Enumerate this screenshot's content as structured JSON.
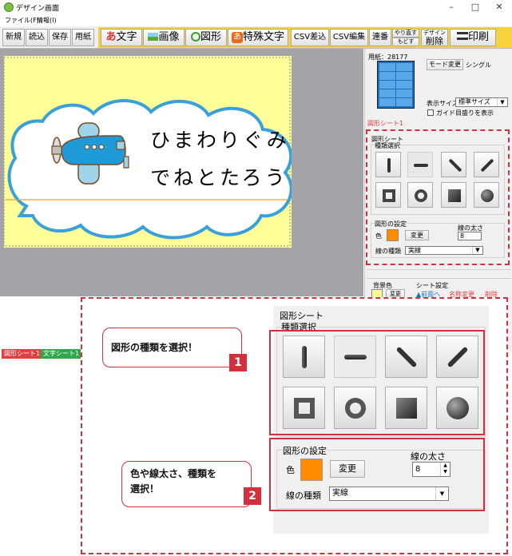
{
  "window": {
    "title": "デザイン画面",
    "minimize_icon": "–",
    "maximize_icon": "□",
    "close_icon": "✕"
  },
  "menu": {
    "file": "ファイル(F)",
    "info": "情報(I)"
  },
  "toolbar": {
    "new": "新規",
    "open": "読込",
    "save": "保存",
    "paper": "用紙",
    "text": "文字",
    "image": "画像",
    "shape": "図形",
    "special_text": "特殊文字",
    "csv_insert": "CSV差込",
    "csv_edit": "CSV編集",
    "serial": "連番",
    "redo": "やり直す",
    "undo": "もどす",
    "design_delete_top": "デザイン",
    "design_delete_bottom": "削除",
    "print": "印刷"
  },
  "canvas": {
    "line1": "ひまわりぐみ",
    "line2": "でねとたろう"
  },
  "sheet_tabs": {
    "shape_sheet": "図形シート1",
    "text_sheet": "文字シート1"
  },
  "right_panel": {
    "paper_label": "用紙：28177",
    "mode_change": "モード変更",
    "mode_value": "シングル",
    "display_size_label": "表示サイズ",
    "display_size_value": "標準サイズ",
    "guide_label": "ガイド目盛りを表示",
    "active_sheet": "図形シート1",
    "shape_sheet_title": "図形シート",
    "type_select": "種類選択",
    "shape_settings": "図形の設定",
    "color_label": "色",
    "change": "変更",
    "line_width_label": "線の太さ",
    "line_width_value": "8",
    "line_type_label": "線の種類",
    "line_type_value": "実線",
    "bg_color_label": "背景色",
    "bg_change": "変更",
    "sheet_settings": "シート設定",
    "front": "▲前面へ",
    "rename": "名称変更",
    "delete": "削除"
  },
  "callouts": {
    "step1": "図形の種類を選択！",
    "step1_num": "1",
    "step2_line1": "色や線太さ、種類を",
    "step2_line2": "選択！",
    "step2_num": "2"
  },
  "colors": {
    "accent_red": "#d32f3c",
    "shape_color": "#ff8c00",
    "paper": "#ffff99",
    "airplane": "#1e9ad6",
    "cloud_border": "#3aa0dc"
  }
}
